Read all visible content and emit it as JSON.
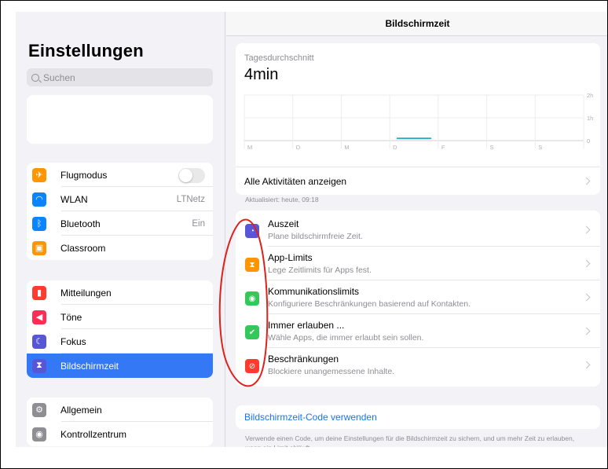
{
  "sidebar": {
    "title": "Einstellungen",
    "search_placeholder": "Suchen",
    "groups": [
      {
        "items": [
          {
            "label": "Flugmodus",
            "value": "",
            "icon": "airplane-icon",
            "color": "#ff9500"
          },
          {
            "label": "WLAN",
            "value": "LTNetz",
            "icon": "wifi-icon",
            "color": "#0a84ff"
          },
          {
            "label": "Bluetooth",
            "value": "Ein",
            "icon": "bluetooth-icon",
            "color": "#0a84ff"
          },
          {
            "label": "Classroom",
            "value": "",
            "icon": "classroom-icon",
            "color": "#ff9500"
          }
        ]
      },
      {
        "items": [
          {
            "label": "Mitteilungen",
            "value": "",
            "icon": "notifications-icon",
            "color": "#ff3b30"
          },
          {
            "label": "Töne",
            "value": "",
            "icon": "sounds-icon",
            "color": "#ff2d55"
          },
          {
            "label": "Fokus",
            "value": "",
            "icon": "focus-moon-icon",
            "color": "#5856d6"
          },
          {
            "label": "Bildschirmzeit",
            "value": "",
            "icon": "hourglass-icon",
            "color": "#5856d6",
            "active": true
          }
        ]
      },
      {
        "items": [
          {
            "label": "Allgemein",
            "value": "",
            "icon": "gear-icon",
            "color": "#8e8e93"
          },
          {
            "label": "Kontrollzentrum",
            "value": "",
            "icon": "control-center-icon",
            "color": "#8e8e93"
          }
        ]
      }
    ]
  },
  "main": {
    "nav_title": "Bildschirmzeit",
    "average_label": "Tagesdurchschnitt",
    "average_value": "4min",
    "all_activity": "Alle Aktivitäten anzeigen",
    "updated": "Aktualisiert: heute, 09:18",
    "features": [
      {
        "title": "Auszeit",
        "subtitle": "Plane bildschirmfreie Zeit.",
        "icon": "downtime-icon",
        "color": "#5856d6"
      },
      {
        "title": "App-Limits",
        "subtitle": "Lege Zeitlimits für Apps fest.",
        "icon": "hourglass-icon",
        "color": "#ff9500"
      },
      {
        "title": "Kommunikationslimits",
        "subtitle": "Konfiguriere Beschränkungen basierend auf Kontakten.",
        "icon": "contact-icon",
        "color": "#34c759"
      },
      {
        "title": "Immer erlauben ...",
        "subtitle": "Wähle Apps, die immer erlaubt sein sollen.",
        "icon": "checkmark-icon",
        "color": "#34c759"
      },
      {
        "title": "Beschränkungen",
        "subtitle": "Blockiere unangemessene Inhalte.",
        "icon": "restriction-icon",
        "color": "#ff3b30"
      }
    ],
    "code_link": "Bildschirmzeit-Code verwenden",
    "code_description": "Verwende einen Code, um deine Einstellungen für die Bildschirmzeit zu sichern, und um mehr Zeit zu erlauben, wenn ein Limit abläuft."
  },
  "chart_data": {
    "type": "bar",
    "categories": [
      "M",
      "D",
      "M",
      "D",
      "F",
      "S",
      "S"
    ],
    "values": [
      0,
      0,
      0,
      4,
      0,
      0,
      0
    ],
    "unit": "min",
    "y_ticks": [
      "2h",
      "1h",
      "0"
    ],
    "ylim": [
      0,
      120
    ],
    "average": 4,
    "bar_color": "#30b0c7"
  },
  "annotation": {
    "color": "#e0201b"
  }
}
